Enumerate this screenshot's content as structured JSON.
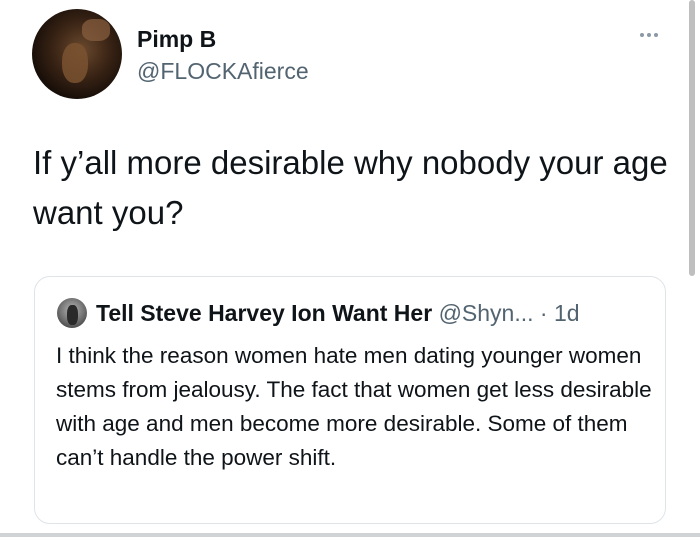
{
  "author": {
    "display_name": "Pimp B",
    "handle": "@FLOCKAfierce"
  },
  "tweet": {
    "text": "If y’all more desirable why nobody your age want you?"
  },
  "quoted_tweet": {
    "display_name": "Tell Steve Harvey Ion Want Her",
    "handle": "@Shyn...",
    "separator": " · ",
    "time": "1d",
    "text": "I think the reason women hate men dating younger women stems from jealousy. The fact that women get less desirable with age and men become more desirable. Some of them can’t handle the power shift."
  },
  "icons": {
    "more": "more-horizontal-icon"
  }
}
